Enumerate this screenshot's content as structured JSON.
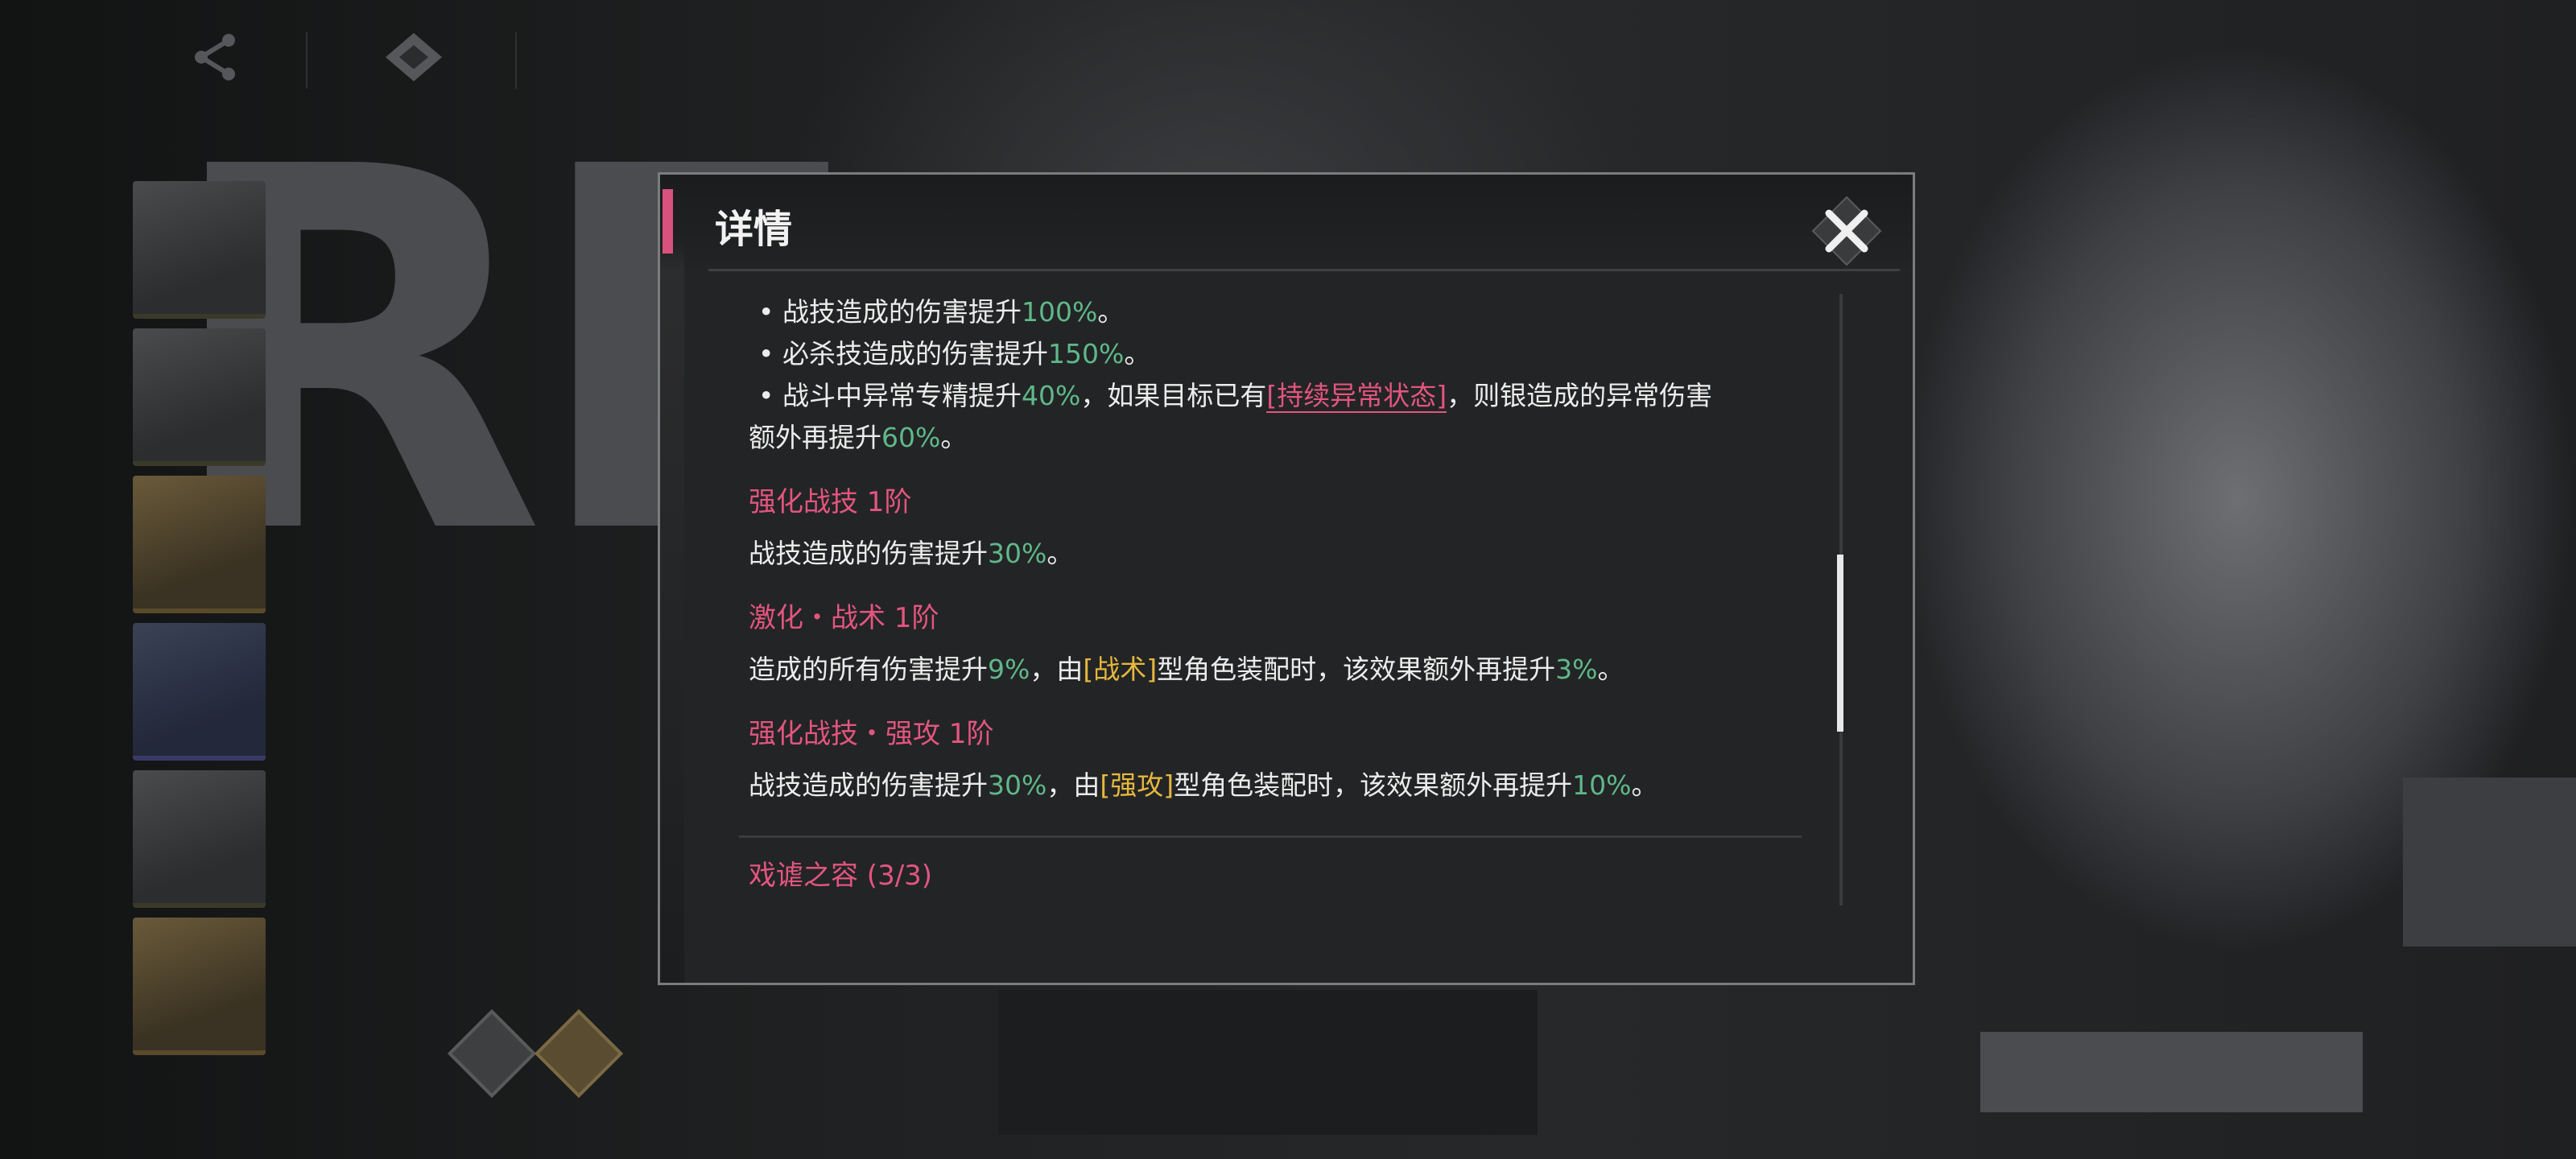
{
  "dialog": {
    "title": "详情",
    "bullets": [
      {
        "prefix": "• 战技造成的伤害提升",
        "value": "100%",
        "suffix": "。"
      },
      {
        "prefix": "• 必杀技造成的伤害提升",
        "value": "150%",
        "suffix": "。"
      },
      {
        "prefix": "• 战斗中异常专精提升",
        "value": "40%",
        "mid": "，如果目标已有",
        "keyword": "[持续异常状态]",
        "suffix": "，则银造成的异常伤害"
      },
      {
        "prefix": "额外再提升",
        "value": "60%",
        "suffix": "。"
      }
    ],
    "sections": [
      {
        "title": "强化战技 1阶",
        "desc_prefix": "战技造成的伤害提升",
        "desc_value": "30%",
        "desc_suffix": "。"
      },
      {
        "title": "激化・战术 1阶",
        "desc_prefix": "造成的所有伤害提升",
        "desc_value": "9%",
        "desc_mid1": "，由",
        "desc_tag": "[战术]",
        "desc_mid2": "型角色装配时，该效果额外再提升",
        "desc_value2": "3%",
        "desc_suffix": "。"
      },
      {
        "title": "强化战技・强攻 1阶",
        "desc_prefix": "战技造成的伤害提升",
        "desc_value": "30%",
        "desc_mid1": "，由",
        "desc_tag": "[强攻]",
        "desc_mid2": "型角色装配时，该效果额外再提升",
        "desc_value2": "10%",
        "desc_suffix": "。"
      }
    ],
    "footer_title": "戏谑之容 (3/3)",
    "scroll_position": 0.6
  },
  "colors": {
    "accent_pink": "#e2557f",
    "value_green": "#5fb88a",
    "tag_yellow": "#e6b73e"
  },
  "icons": {
    "close": "close-x-icon",
    "share": "share-icon",
    "diamond": "diamond-icon"
  }
}
